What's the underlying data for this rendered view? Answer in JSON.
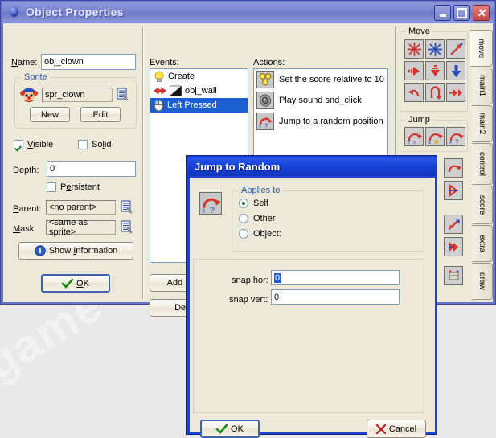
{
  "desktop": {
    "watermark": "game maker",
    "watermark2": "game maker"
  },
  "window": {
    "title": "Object Properties",
    "icon": "object-ball-icon",
    "buttons": {
      "minimize": "minimize-button",
      "maximize": "maximize-button",
      "close": "close-button"
    }
  },
  "left_panel": {
    "name_label": "Name:",
    "name_value": "obj_clown",
    "sprite_group": "Sprite",
    "sprite_value": "spr_clown",
    "sprite_new": "New",
    "sprite_edit": "Edit",
    "visible_label": "Visible",
    "visible_checked": true,
    "solid_label": "Solid",
    "solid_checked": false,
    "depth_label": "Depth:",
    "depth_value": "0",
    "persistent_label": "Persistent",
    "persistent_checked": false,
    "parent_label": "Parent:",
    "parent_value": "<no parent>",
    "mask_label": "Mask:",
    "mask_value": "<same as sprite>",
    "show_information": "Show Information",
    "ok_button": "OK"
  },
  "events": {
    "header": "Events:",
    "items": [
      {
        "label": "Create",
        "icon": "lightbulb-icon",
        "selected": false
      },
      {
        "label": "obj_wall",
        "icon": "collision-icon",
        "selected": false
      },
      {
        "label": "Left Pressed",
        "icon": "mouse-icon",
        "selected": true
      }
    ],
    "add_event_button": "Add Event",
    "delete_button": "Delete"
  },
  "actions": {
    "header": "Actions:",
    "items": [
      {
        "label": "Set the score relative to 10",
        "icon": "score-coins-icon"
      },
      {
        "label": "Play sound snd_click",
        "icon": "speaker-icon"
      },
      {
        "label": "Jump to a random position",
        "icon": "jump-random-icon"
      }
    ]
  },
  "palette": {
    "groups": [
      {
        "label": "Move",
        "icons": [
          "move-fixed-icon",
          "move-free-icon",
          "move-towards-icon",
          "set-hspeed-icon",
          "set-vspeed-icon",
          "set-gravity-icon",
          "reverse-hor-icon",
          "reverse-vert-icon",
          "set-friction-icon"
        ]
      },
      {
        "label": "Jump",
        "icons": [
          "jump-position-icon",
          "jump-start-icon",
          "jump-random-icon"
        ]
      }
    ]
  },
  "tabs": [
    {
      "label": "move",
      "active": true
    },
    {
      "label": "main1",
      "active": false
    },
    {
      "label": "main2",
      "active": false
    },
    {
      "label": "control",
      "active": false
    },
    {
      "label": "score",
      "active": false
    },
    {
      "label": "extra",
      "active": false
    },
    {
      "label": "draw",
      "active": false
    }
  ],
  "dialog": {
    "title": "Jump to Random",
    "icon": "jump-random-icon",
    "applies_to_label": "Applies to",
    "options": [
      {
        "label": "Self",
        "selected": true
      },
      {
        "label": "Other",
        "selected": false
      },
      {
        "label": "Object:",
        "selected": false
      }
    ],
    "snap_hor_label": "snap hor:",
    "snap_hor_value": "0",
    "snap_vert_label": "snap vert:",
    "snap_vert_value": "0",
    "ok_button": "OK",
    "cancel_button": "Cancel"
  },
  "colors": {
    "title_blue": "#7984cf",
    "dialog_blue": "#1b43d6",
    "selection_blue": "#1c5fd4",
    "face": "#ece9d8",
    "accent_red": "#d0342c",
    "accent_green": "#107a10"
  }
}
